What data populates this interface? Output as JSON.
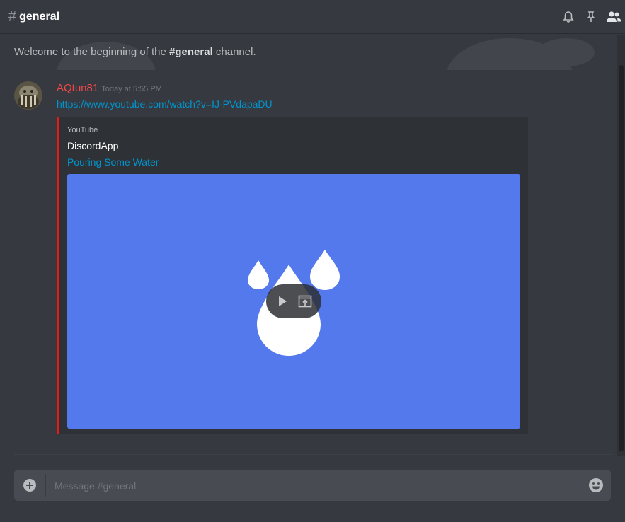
{
  "header": {
    "hash": "#",
    "channel_name": "general",
    "icons": [
      "bell-icon",
      "pin-icon",
      "members-icon"
    ]
  },
  "welcome": {
    "prefix": "Welcome to the beginning of the ",
    "channel": "#general",
    "suffix": " channel."
  },
  "message": {
    "author": "AQtun81",
    "timestamp": "Today at 5:55 PM",
    "link": "https://www.youtube.com/watch?v=IJ-PVdapaDU",
    "embed": {
      "provider": "YouTube",
      "author": "DiscordApp",
      "title": "Pouring Some Water",
      "accent_color": "#e91916",
      "thumbnail_bg": "#5479ec"
    }
  },
  "composer": {
    "placeholder": "Message #general"
  },
  "colors": {
    "background": "#36393f",
    "author_name": "#f04747",
    "link": "#0096cf"
  }
}
